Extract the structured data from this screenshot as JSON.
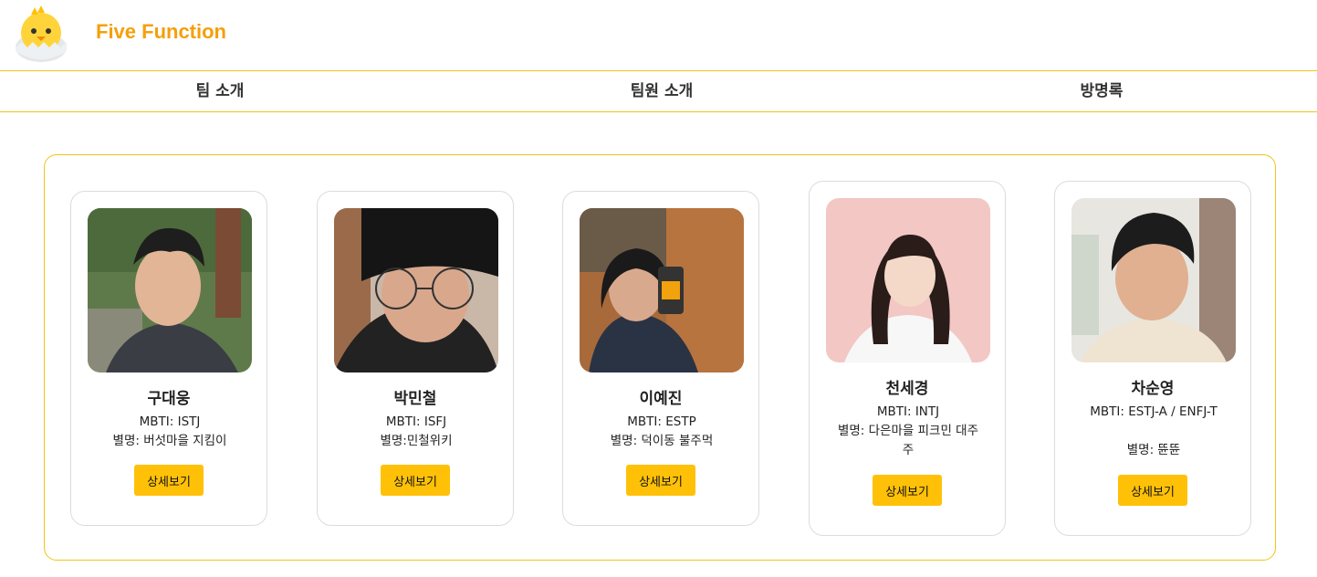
{
  "header": {
    "brand": "Five Function",
    "logo_icon": "chick-icon"
  },
  "nav": {
    "items": [
      {
        "label": "팀 소개"
      },
      {
        "label": "팀원 소개"
      },
      {
        "label": "방명록"
      }
    ]
  },
  "colors": {
    "accent": "#f59f0a",
    "button": "#ffc107",
    "border": "#f0c419"
  },
  "members": [
    {
      "name": "구대웅",
      "mbti": "MBTI: ISTJ",
      "nickname": "별명: 버섯마을 지킴이",
      "button": "상세보기"
    },
    {
      "name": "박민철",
      "mbti": "MBTI: ISFJ",
      "nickname": "별명:민철위키",
      "button": "상세보기"
    },
    {
      "name": "이예진",
      "mbti": "MBTI: ESTP",
      "nickname": "별명: 덕이동 불주먹",
      "button": "상세보기"
    },
    {
      "name": "천세경",
      "mbti": "MBTI: INTJ",
      "nickname": "별명: 다은마을 피크민 대주주",
      "button": "상세보기"
    },
    {
      "name": "차순영",
      "mbti": "MBTI: ESTJ-A / ENFJ-T",
      "nickname": "별명: 뜐뜐",
      "button": "상세보기"
    }
  ]
}
